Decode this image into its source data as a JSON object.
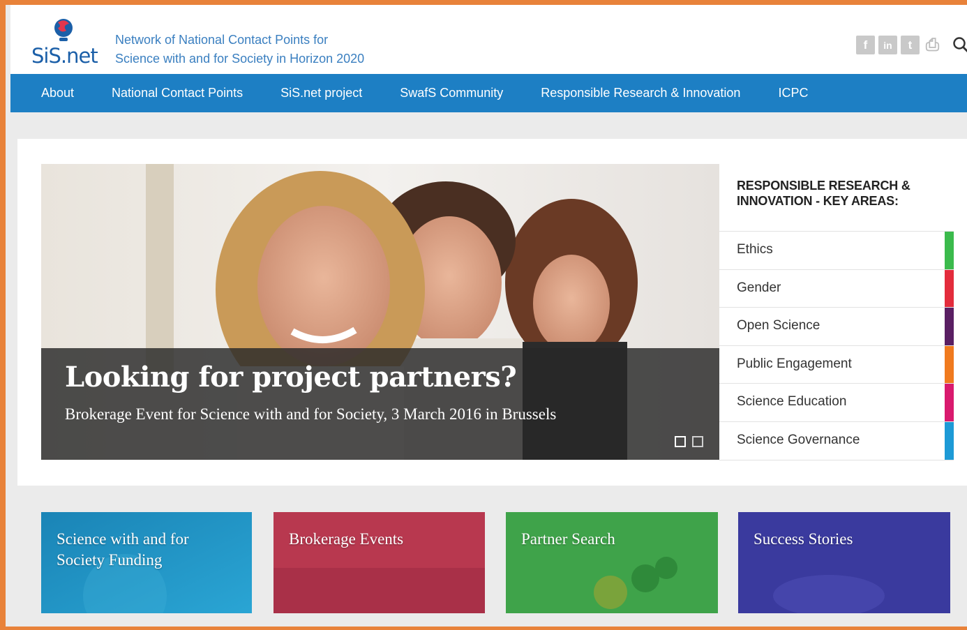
{
  "brand": {
    "name": "SiS.net",
    "tagline_line1": "Network of National Contact Points for",
    "tagline_line2": "Science with and for Society in Horizon 2020"
  },
  "social": {
    "icons": [
      "facebook-icon",
      "linkedin-icon",
      "twitter-icon",
      "print-icon"
    ],
    "facebook": "f",
    "linkedin": "in",
    "twitter": "t",
    "print": "⎙"
  },
  "nav": {
    "items": [
      "About",
      "National Contact Points",
      "SiS.net project",
      "SwafS Community",
      "Responsible Research & Innovation",
      "ICPC"
    ]
  },
  "hero": {
    "headline": "Looking for project partners?",
    "subtitle": "Brokerage Event for Science with and for Society, 3 March 2016 in Brussels"
  },
  "rri": {
    "title_line1": "RESPONSIBLE RESEARCH &",
    "title_line2": "INNOVATION - KEY AREAS:",
    "items": [
      {
        "label": "Ethics",
        "color": "#3bba4c"
      },
      {
        "label": "Gender",
        "color": "#e32c3c"
      },
      {
        "label": "Open Science",
        "color": "#5a1f63"
      },
      {
        "label": "Public Engagement",
        "color": "#f07a1e"
      },
      {
        "label": "Science Education",
        "color": "#d91a6e"
      },
      {
        "label": "Science Governance",
        "color": "#1d9ad6"
      }
    ]
  },
  "tiles": [
    {
      "line1": "Science with and for",
      "line2": "Society Funding",
      "color": "#1f8fbd"
    },
    {
      "line1": "Brokerage Events",
      "line2": "",
      "color": "#b8384f"
    },
    {
      "line1": "Partner Search",
      "line2": "",
      "color": "#3fa34a"
    },
    {
      "line1": "Success Stories",
      "line2": "",
      "color": "#3a3a9e"
    }
  ],
  "colors": {
    "accent_frame": "#e8823a",
    "nav": "#1d7fc4",
    "brand_blue": "#1b5fa8"
  }
}
